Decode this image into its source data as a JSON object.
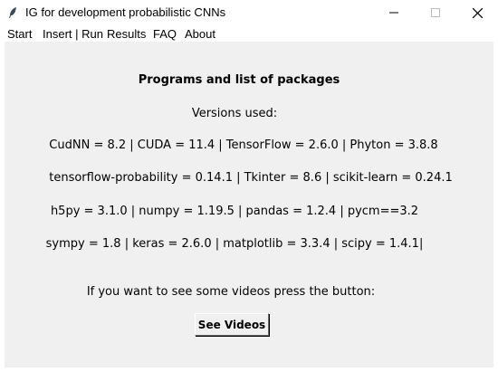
{
  "window": {
    "title": "IG for development probabilistic CNNs",
    "icon": "feather-icon"
  },
  "menubar": {
    "items": [
      "Start",
      "Insert | Run",
      "Results",
      "FAQ",
      "About"
    ]
  },
  "main": {
    "heading": "Programs and list of packages",
    "versions_label": "Versions used:",
    "version_lines": [
      "CudNN = 8.2 | CUDA = 11.4 | TensorFlow = 2.6.0 | Phyton = 3.8.8",
      "tensorflow-probability = 0.14.1 | Tkinter = 8.6 | scikit-learn = 0.24.1",
      "h5py = 3.1.0 | numpy = 1.19.5 | pandas = 1.2.4 | pycm==3.2",
      "sympy = 1.8 | keras = 2.6.0 | matplotlib = 3.3.4 | scipy = 1.4.1|"
    ],
    "videos_prompt": "If you want to see some videos press the button:",
    "videos_button": "See Videos"
  },
  "colors": {
    "content_bg": "#f0f0f0",
    "window_bg": "#ffffff",
    "text": "#000000"
  }
}
